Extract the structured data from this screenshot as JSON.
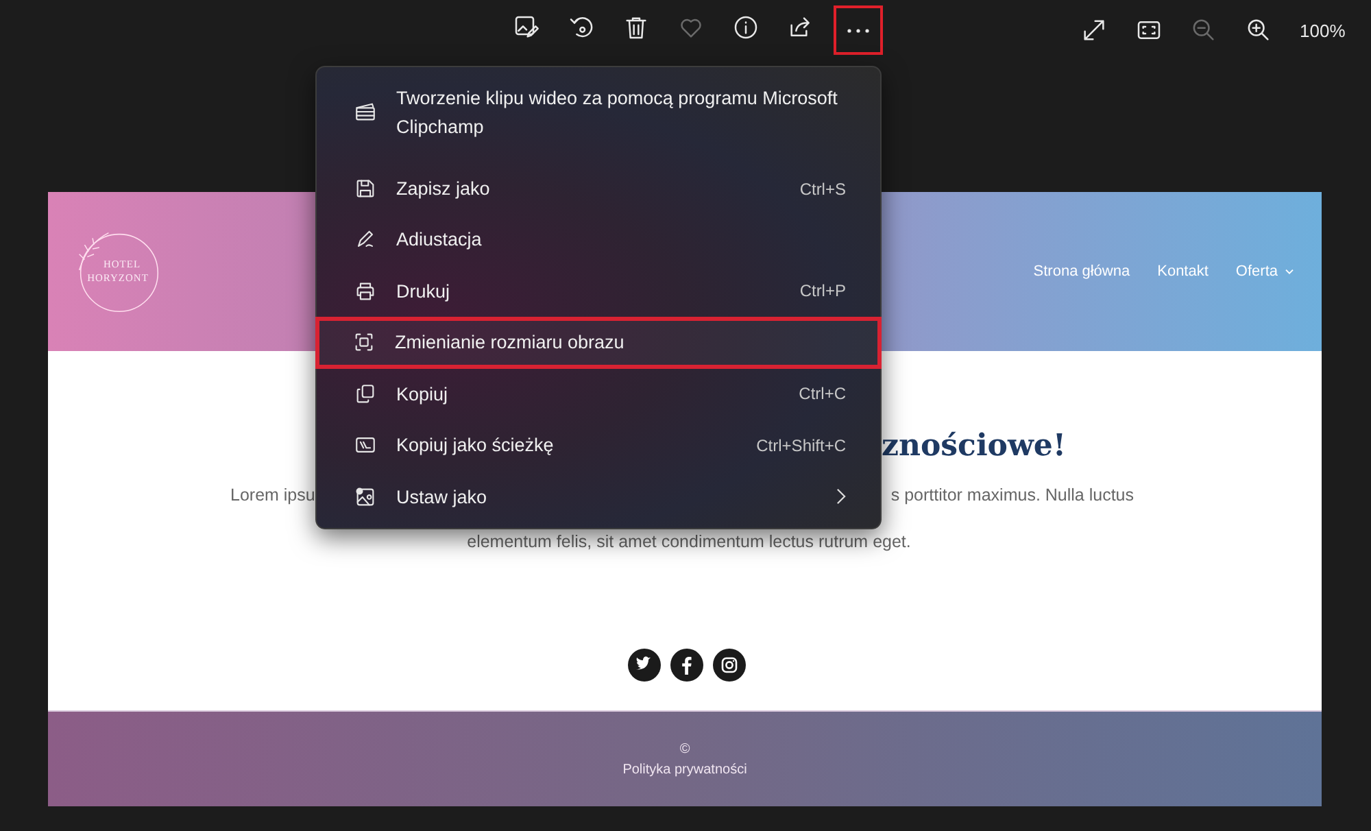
{
  "toolbar": {
    "left_buttons": [
      {
        "kind": "edit",
        "disabled": false,
        "selected": false
      },
      {
        "kind": "rotate",
        "disabled": false,
        "selected": false
      },
      {
        "kind": "delete",
        "disabled": false,
        "selected": false
      },
      {
        "kind": "favorite",
        "disabled": true,
        "selected": false
      },
      {
        "kind": "info",
        "disabled": false,
        "selected": false
      },
      {
        "kind": "share",
        "disabled": false,
        "selected": false
      },
      {
        "kind": "more",
        "disabled": false,
        "selected": true
      }
    ],
    "right_buttons": [
      {
        "kind": "fullscreen",
        "disabled": false
      },
      {
        "kind": "fit",
        "disabled": false
      },
      {
        "kind": "zoom-out",
        "disabled": true
      },
      {
        "kind": "zoom-in",
        "disabled": false
      }
    ],
    "zoom_level": "100%"
  },
  "image": {
    "logo": {
      "line_1": "HOTEL",
      "line_2": "HORYZONT"
    },
    "nav": [
      {
        "label": "Strona główna",
        "dropdown": false
      },
      {
        "label": "Kontakt",
        "dropdown": false
      },
      {
        "label": "Oferta",
        "dropdown": true
      }
    ],
    "heading": "znościowe!",
    "text_left": "Lorem ipsu",
    "text_right": "s porttitor maximus. Nulla luctus",
    "text_line_2": "elementum felis, sit amet condimentum lectus rutrum eget.",
    "social": [
      {
        "kind": "twitter"
      },
      {
        "kind": "facebook"
      },
      {
        "kind": "instagram"
      }
    ],
    "footer": {
      "copyright": "©",
      "link": "Polityka prywatności"
    }
  },
  "menu": {
    "items": [
      {
        "kind": "video",
        "label": "Tworzenie klipu wideo za pomocą programu Microsoft Clipchamp",
        "selected": false,
        "submenu": false
      },
      {
        "kind": "save",
        "label": "Zapisz jako",
        "shortcut": "Ctrl+S",
        "selected": false,
        "submenu": false
      },
      {
        "kind": "pen",
        "label": "Adiustacja",
        "selected": false,
        "submenu": false
      },
      {
        "kind": "print",
        "label": "Drukuj",
        "shortcut": "Ctrl+P",
        "selected": false,
        "submenu": false
      },
      {
        "kind": "resize",
        "label": "Zmienianie rozmiaru obrazu",
        "selected": true,
        "submenu": false
      },
      {
        "kind": "copy",
        "label": "Kopiuj",
        "shortcut": "Ctrl+C",
        "selected": false,
        "submenu": false
      },
      {
        "kind": "path",
        "label": "Kopiuj jako ścieżkę",
        "shortcut": "Ctrl+Shift+C",
        "selected": false,
        "submenu": false
      },
      {
        "kind": "set-as",
        "label": "Ustaw jako",
        "selected": false,
        "submenu": true
      }
    ]
  }
}
